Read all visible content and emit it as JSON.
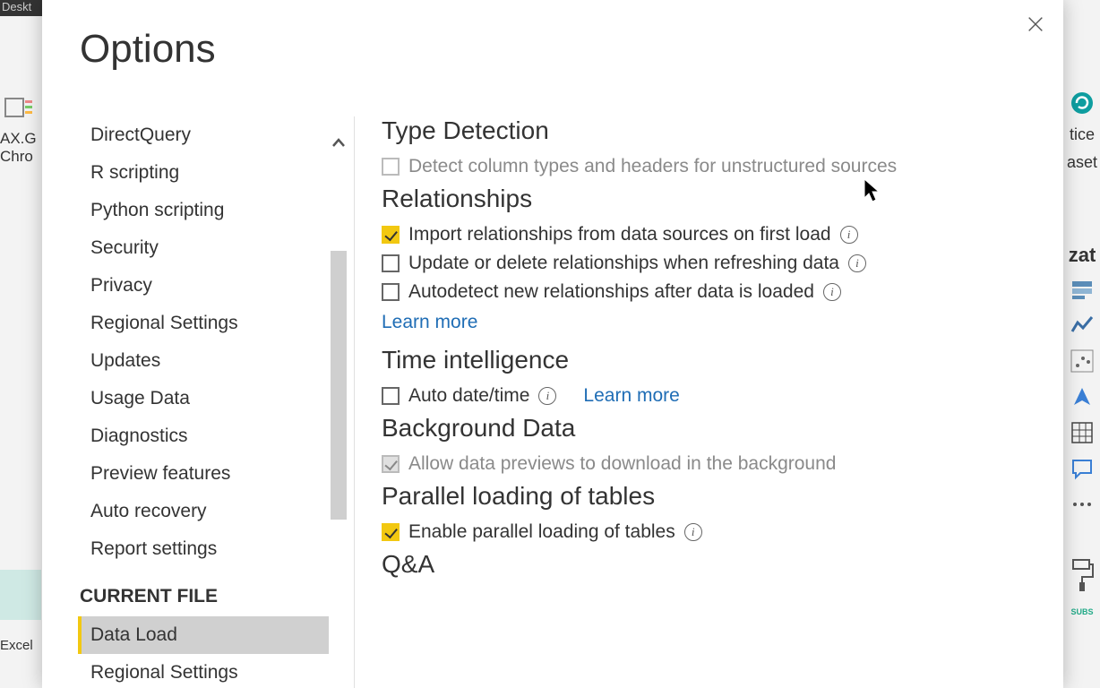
{
  "bg": {
    "titlebar": "Deskt",
    "left_lines": [
      "AX.G",
      "Chro"
    ],
    "excel": "Excel",
    "right_lines": [
      "tice",
      "aset",
      "zat"
    ]
  },
  "dialog": {
    "title": "Options"
  },
  "sidebar": {
    "items_global": [
      "DirectQuery",
      "R scripting",
      "Python scripting",
      "Security",
      "Privacy",
      "Regional Settings",
      "Updates",
      "Usage Data",
      "Diagnostics",
      "Preview features",
      "Auto recovery",
      "Report settings"
    ],
    "section_label": "CURRENT FILE",
    "items_current": [
      "Data Load",
      "Regional Settings"
    ],
    "selected": "Data Load"
  },
  "content": {
    "sections": {
      "type_detection": {
        "heading": "Type Detection",
        "opt1": {
          "label": "Detect column types and headers for unstructured sources",
          "checked": false,
          "disabled": true
        }
      },
      "relationships": {
        "heading": "Relationships",
        "opt1": {
          "label": "Import relationships from data sources on first load",
          "checked": true
        },
        "opt2": {
          "label": "Update or delete relationships when refreshing data",
          "checked": false
        },
        "opt3": {
          "label": "Autodetect new relationships after data is loaded",
          "checked": false
        },
        "learn_more": "Learn more"
      },
      "time_intel": {
        "heading": "Time intelligence",
        "opt1": {
          "label": "Auto date/time",
          "checked": false
        },
        "learn_more": "Learn more"
      },
      "bg_data": {
        "heading": "Background Data",
        "opt1": {
          "label": "Allow data previews to download in the background",
          "checked": true,
          "disabled": true
        }
      },
      "parallel": {
        "heading": "Parallel loading of tables",
        "opt1": {
          "label": "Enable parallel loading of tables",
          "checked": true
        }
      },
      "qa": {
        "heading": "Q&A"
      }
    }
  }
}
